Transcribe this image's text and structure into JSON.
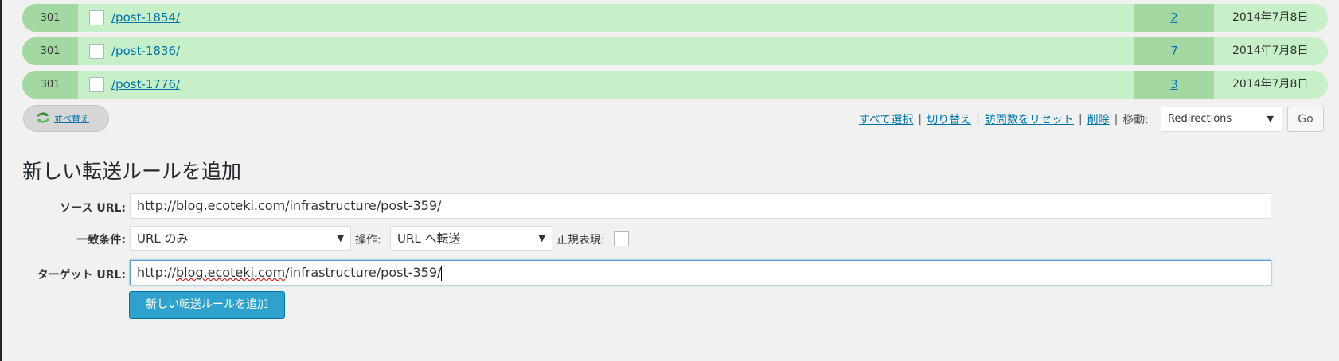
{
  "redirects": [
    {
      "code": "301",
      "url": "/post-1854/",
      "hits": "2",
      "date": "2014年7月8日"
    },
    {
      "code": "301",
      "url": "/post-1836/",
      "hits": "7",
      "date": "2014年7月8日"
    },
    {
      "code": "301",
      "url": "/post-1776/",
      "hits": "3",
      "date": "2014年7月8日"
    }
  ],
  "sort_button": {
    "label": "並べ替え"
  },
  "bulk_actions": {
    "select_all": "すべて選択",
    "toggle": "切り替え",
    "reset_hits": "訪問数をリセット",
    "delete": "削除",
    "separator": "|",
    "move_label": "移動:",
    "move_value": "Redirections",
    "go": "Go"
  },
  "add_form": {
    "title": "新しい転送ルールを追加",
    "source_label": "ソース URL:",
    "source_value": "http://blog.ecoteki.com/infrastructure/post-359/",
    "match_label": "一致条件:",
    "match_value": "URL のみ",
    "action_label": "操作:",
    "action_value": "URL へ転送",
    "regex_label": "正規表現:",
    "target_label": "ターゲット URL:",
    "target_value_prefix": "http://",
    "target_value_squiggle": "blog.ecoteki.com",
    "target_value_suffix": "/infrastructure/post-359/",
    "submit": "新しい転送ルールを追加"
  },
  "colors": {
    "row_bg": "#c8f0c8",
    "row_accent": "#a3d8a3",
    "link": "#0073aa",
    "button_primary": "#2ea2cc"
  }
}
